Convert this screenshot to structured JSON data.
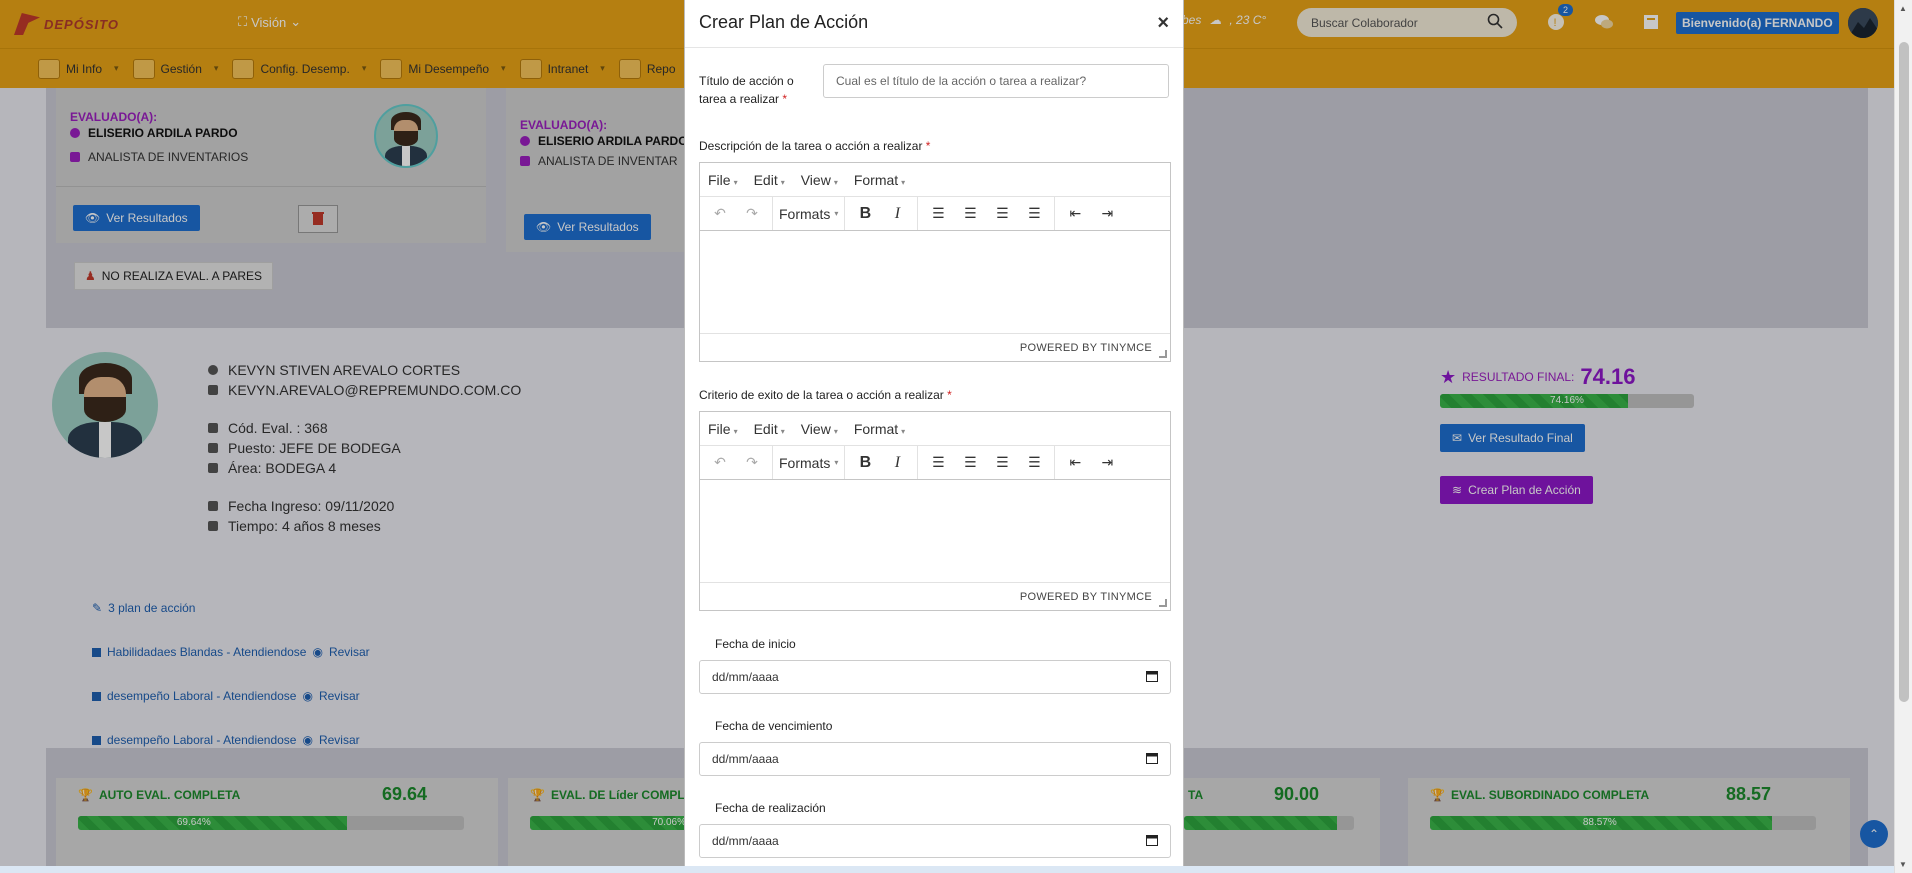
{
  "header": {
    "logo_text": "DEPÓSITO",
    "vision_label": "Visión",
    "weather_text": "bes",
    "temperature": ", 23 C°",
    "search_placeholder": "Buscar Colaborador",
    "notification_count": "2",
    "welcome_text": "Bienvenido(a) FERNANDO"
  },
  "nav": {
    "items": [
      {
        "label": "Mi Info",
        "icon": "id-card-icon"
      },
      {
        "label": "Gestión",
        "icon": "steps-icon"
      },
      {
        "label": "Config. Desemp.",
        "icon": "box-icon"
      },
      {
        "label": "Mi Desempeño",
        "icon": "award-icon"
      },
      {
        "label": "Intranet",
        "icon": "network-icon"
      },
      {
        "label": "Repo",
        "icon": "bar-chart-icon"
      }
    ]
  },
  "background": {
    "card1": {
      "label": "EVALUADO(A):",
      "name": "ELISERIO ARDILA PARDO",
      "role": "ANALISTA DE INVENTARIOS",
      "button": "Ver Resultados"
    },
    "card2": {
      "label": "EVALUADO(A):",
      "name": "ELISERIO ARDILA PARDO",
      "role": "ANALISTA DE INVENTAR",
      "button": "Ver Resultados"
    },
    "no_pares": "NO REALIZA EVAL. A PARES",
    "employee": {
      "name": "KEVYN STIVEN AREVALO CORTES",
      "email": "KEVYN.AREVALO@REPREMUNDO.COM.CO",
      "code_label": "Cód. Eval. :",
      "code_value": "368",
      "puesto_label": "Puesto:",
      "puesto_value": "JEFE DE BODEGA",
      "area_label": "Área:",
      "area_value": "BODEGA 4",
      "ingreso_label": "Fecha Ingreso:",
      "ingreso_value": "09/11/2020",
      "tiempo_label": "Tiempo:",
      "tiempo_value": "4 años 8 meses"
    },
    "plans": {
      "count_label": "3 plan de acción",
      "items": [
        {
          "label": "Habilidadaes Blandas - Atendiendose",
          "action": "Revisar"
        },
        {
          "label": "desempeño Laboral - Atendiendose",
          "action": "Revisar"
        },
        {
          "label": "desempeño Laboral - Atendiendose",
          "action": "Revisar"
        }
      ]
    },
    "result": {
      "title": "RESULTADO FINAL:",
      "value": "74.16",
      "percent": 74.16,
      "percent_label": "74.16%",
      "view_button": "Ver Resultado Final",
      "create_button": "Crear Plan de Acción"
    },
    "scores": [
      {
        "title": "AUTO EVAL. COMPLETA",
        "value": "69.64",
        "percent": 69.64,
        "percent_label": "69.64%"
      },
      {
        "title": "EVAL. DE Líder COMPL",
        "value": "",
        "percent": 70.06,
        "percent_label": "70.06%"
      },
      {
        "title": "TA",
        "value": "90.00",
        "percent": 90.0,
        "percent_label": ""
      },
      {
        "title": "EVAL. SUBORDINADO COMPLETA",
        "value": "88.57",
        "percent": 88.57,
        "percent_label": "88.57%"
      }
    ]
  },
  "modal": {
    "title": "Crear Plan de Acción",
    "close": "×",
    "title_field": {
      "label_line1": "Título de acción o",
      "label_line2": "tarea a realizar",
      "required": "*",
      "placeholder": "Cual es el título de la acción o tarea a realizar?"
    },
    "description_label": "Descripción de la tarea o acción a realizar",
    "criteria_label": "Criterio de exito de la tarea o acción a realizar",
    "required_mark": "*",
    "editor": {
      "menu": [
        "File",
        "Edit",
        "View",
        "Format"
      ],
      "formats_label": "Formats",
      "powered_by": "POWERED BY TINYMCE"
    },
    "dates": [
      {
        "label": "Fecha de inicio",
        "placeholder": "dd/mm/aaaa"
      },
      {
        "label": "Fecha de vencimiento",
        "placeholder": "dd/mm/aaaa"
      },
      {
        "label": "Fecha de realización",
        "placeholder": "dd/mm/aaaa"
      }
    ]
  },
  "colors": {
    "topbar": "#e8a317",
    "primary_blue": "#1e6fd0",
    "purple": "#8e18c8",
    "green": "#1c8a2c"
  }
}
